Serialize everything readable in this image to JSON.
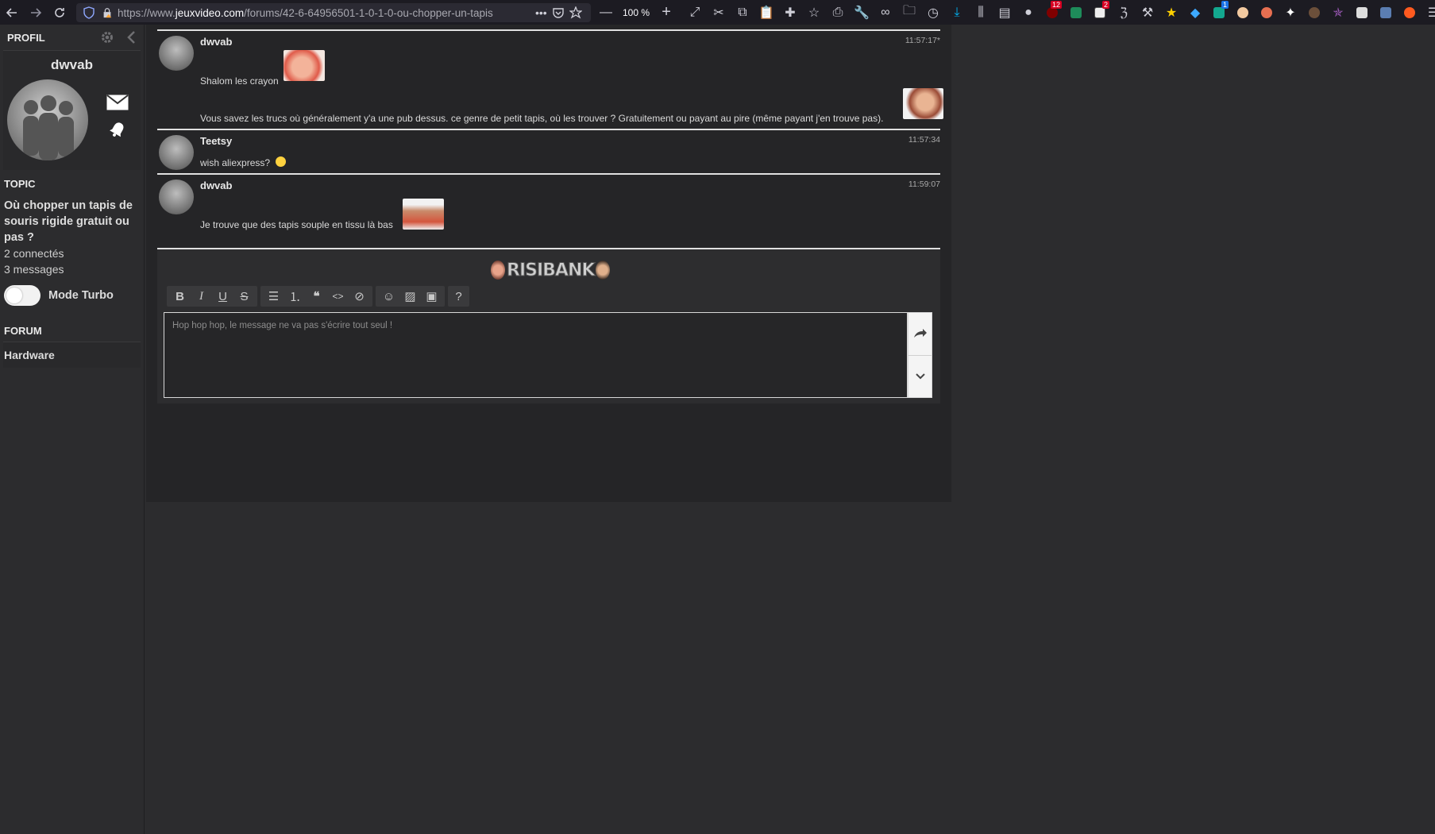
{
  "browser": {
    "url_prefix": "https://www.",
    "url_domain": "jeuxvideo.com",
    "url_rest": "/forums/42-6-64956501-1-0-1-0-ou-chopper-un-tapis",
    "zoom": "100 %",
    "badges": {
      "ublock": "12",
      "ext2": "2",
      "ext3": "1"
    }
  },
  "sidebar": {
    "profile_label": "PROFIL",
    "username": "dwvab",
    "topic_label": "TOPIC",
    "topic_title": "Où chopper un tapis de souris rigide gratuit ou pas ?",
    "connected": "2 connectés",
    "messages": "3 messages",
    "turbo_label": "Mode Turbo",
    "forum_label": "FORUM",
    "forum_name": "Hardware"
  },
  "messages": [
    {
      "author": "dwvab",
      "time": "11:57:17*",
      "line1": "Shalom les crayon",
      "line2": "Vous savez les trucs où généralement y'a une pub dessus. ce genre de petit tapis, où les trouver ? Gratuitement ou payant au pire (même payant j'en trouve pas)."
    },
    {
      "author": "Teetsy",
      "time": "11:57:34",
      "line1": "wish aliexpress?"
    },
    {
      "author": "dwvab",
      "time": "11:59:07",
      "line1": "Je trouve que des tapis souple en tissu là bas"
    }
  ],
  "reply": {
    "risibank": "RISIBANK",
    "placeholder": "Hop hop hop, le message ne va pas s'écrire tout seul !",
    "help": "?"
  },
  "colors": {
    "toolbar_bg": "#1c1b22",
    "page_bg": "#2c2c2e",
    "main_bg": "#252527",
    "text": "#d9d9d9"
  }
}
